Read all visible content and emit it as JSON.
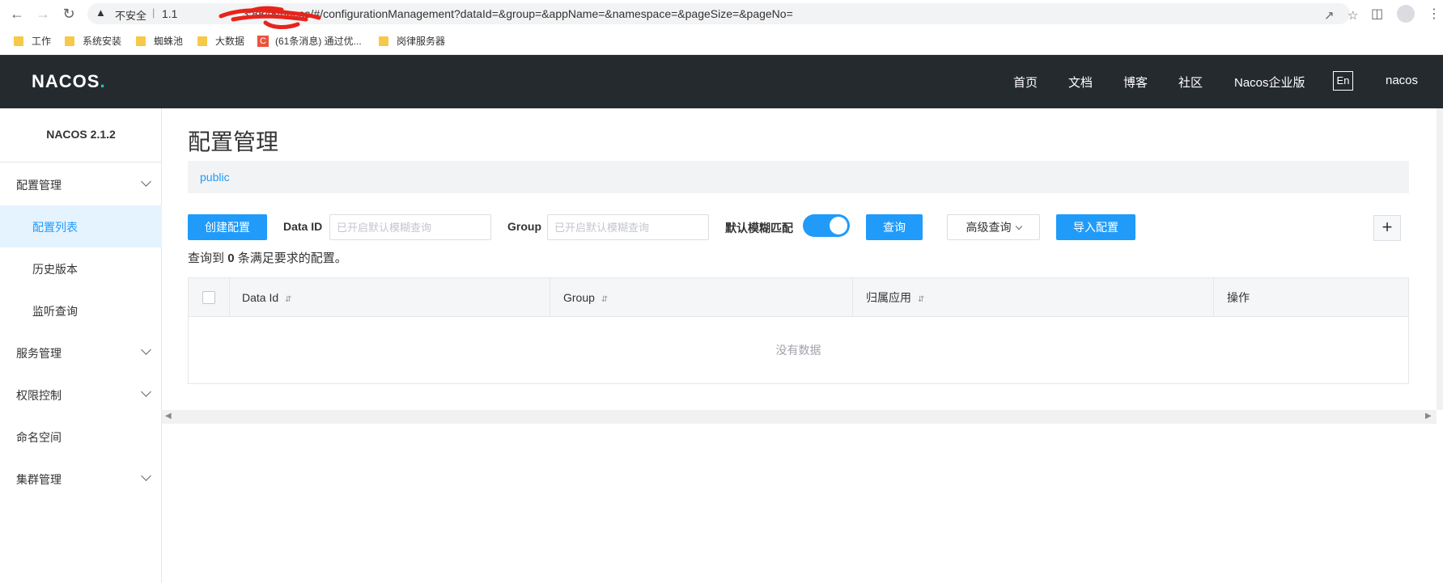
{
  "browser": {
    "back_icon": "arrow-left-icon",
    "forward_icon": "arrow-right-icon",
    "reload_icon": "reload-icon",
    "insecure_label": "不安全",
    "url": "1.1        3:8848/nacos/#/configurationManagement?dataId=&group=&appName=&namespace=&pageSize=&pageNo=",
    "url_visible": "3:8848/nacos/#/configurationManagement?dataId=&group=&appName=&namespace=&pageSize=&pageNo=",
    "url_prefix": "1.1",
    "bookmarks": [
      {
        "label": "工作",
        "icon": "folder-icon"
      },
      {
        "label": "系统安装",
        "icon": "folder-icon"
      },
      {
        "label": "蜘蛛池",
        "icon": "folder-icon"
      },
      {
        "label": "大数据",
        "icon": "folder-icon"
      },
      {
        "label": "(61条消息) 通过优...",
        "icon": "csdn-icon"
      },
      {
        "label": "岗律服务器",
        "icon": "folder-icon"
      }
    ]
  },
  "header": {
    "logo": "NACOS",
    "nav": [
      "首页",
      "文档",
      "博客",
      "社区",
      "Nacos企业版"
    ],
    "lang": "En",
    "user": "nacos"
  },
  "sidebar": {
    "version": "NACOS 2.1.2",
    "items": [
      {
        "label": "配置管理",
        "expandable": true
      },
      {
        "label": "配置列表",
        "active": true
      },
      {
        "label": "历史版本"
      },
      {
        "label": "监听查询"
      },
      {
        "label": "服务管理",
        "expandable": true
      },
      {
        "label": "权限控制",
        "expandable": true
      },
      {
        "label": "命名空间"
      },
      {
        "label": "集群管理",
        "expandable": true
      }
    ]
  },
  "main": {
    "title": "配置管理",
    "namespace": "public",
    "create_button": "创建配置",
    "dataid_label": "Data ID",
    "dataid_placeholder": "已开启默认模糊查询",
    "group_label": "Group",
    "group_placeholder": "已开启默认模糊查询",
    "fuzzy_label": "默认模糊匹配",
    "fuzzy_enabled": true,
    "query_button": "查询",
    "advanced_query": "高级查询",
    "import_button": "导入配置",
    "plus_button": "+",
    "summary_prefix": "查询到",
    "summary_count": "0",
    "summary_suffix": "条满足要求的配置。"
  },
  "table": {
    "columns": [
      "Data Id",
      "Group",
      "归属应用",
      "操作"
    ],
    "empty_text": "没有数据"
  },
  "colors": {
    "header_bg": "#252a2f",
    "primary": "#209bfa",
    "logo_accent": "#1ac7c6",
    "active_bg": "#e5f3ff"
  }
}
